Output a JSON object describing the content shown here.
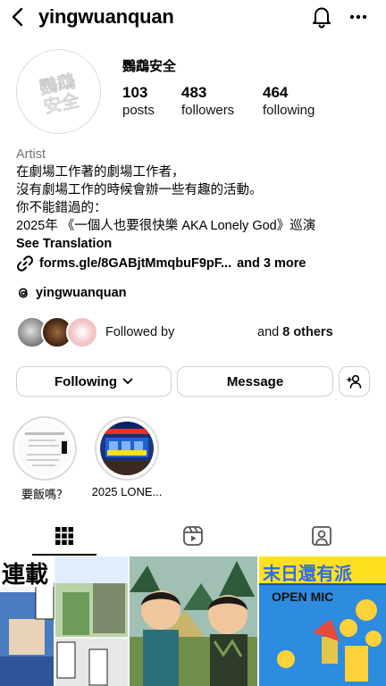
{
  "header": {
    "username": "yingwuanquan",
    "back_icon": "chevron-left-icon",
    "notifications_icon": "bell-icon",
    "more_icon": "more-horizontal-icon"
  },
  "profile": {
    "display_name": "鸚鵡安全",
    "avatar_text": "鸚鵡安全",
    "stats": {
      "posts": {
        "count": "103",
        "label": "posts"
      },
      "followers": {
        "count": "483",
        "label": "followers"
      },
      "following": {
        "count": "464",
        "label": "following"
      }
    },
    "category": "Artist",
    "bio_lines": [
      "在劇場工作著的劇場工作者，",
      "沒有劇場工作的時候會辦一些有趣的活動。",
      "你不能錯過的：",
      "2025年 《一個人也要很快樂 AKA Lonely God》巡演"
    ],
    "see_translation": "See Translation",
    "link": {
      "text": "forms.gle/8GABjtMmqbuF9pF...",
      "more": "and 3 more",
      "icon": "link-icon"
    },
    "threads": {
      "handle": "yingwuanquan",
      "icon": "threads-icon"
    },
    "followed_by": {
      "prefix": "Followed by",
      "and": "and",
      "others": "8 others"
    }
  },
  "actions": {
    "following_label": "Following",
    "message_label": "Message",
    "add_user_icon": "add-user-icon"
  },
  "highlights": [
    {
      "caption": "要飯嗎？"
    },
    {
      "caption": "2025 LONE..."
    }
  ],
  "tabs": [
    {
      "name": "posts-grid",
      "icon": "grid-icon",
      "active": true
    },
    {
      "name": "reels",
      "icon": "reels-icon",
      "active": false
    },
    {
      "name": "tagged",
      "icon": "tagged-person-icon",
      "active": false
    }
  ],
  "posts": [
    {
      "title": "連載"
    },
    {
      "title": ""
    },
    {
      "title": "末日還有派",
      "subtitle": "OPEN MIC"
    }
  ],
  "colors": {
    "text": "#000000",
    "secondary_text": "#737373",
    "border": "#dbdbdb",
    "background": "#ffffff"
  }
}
